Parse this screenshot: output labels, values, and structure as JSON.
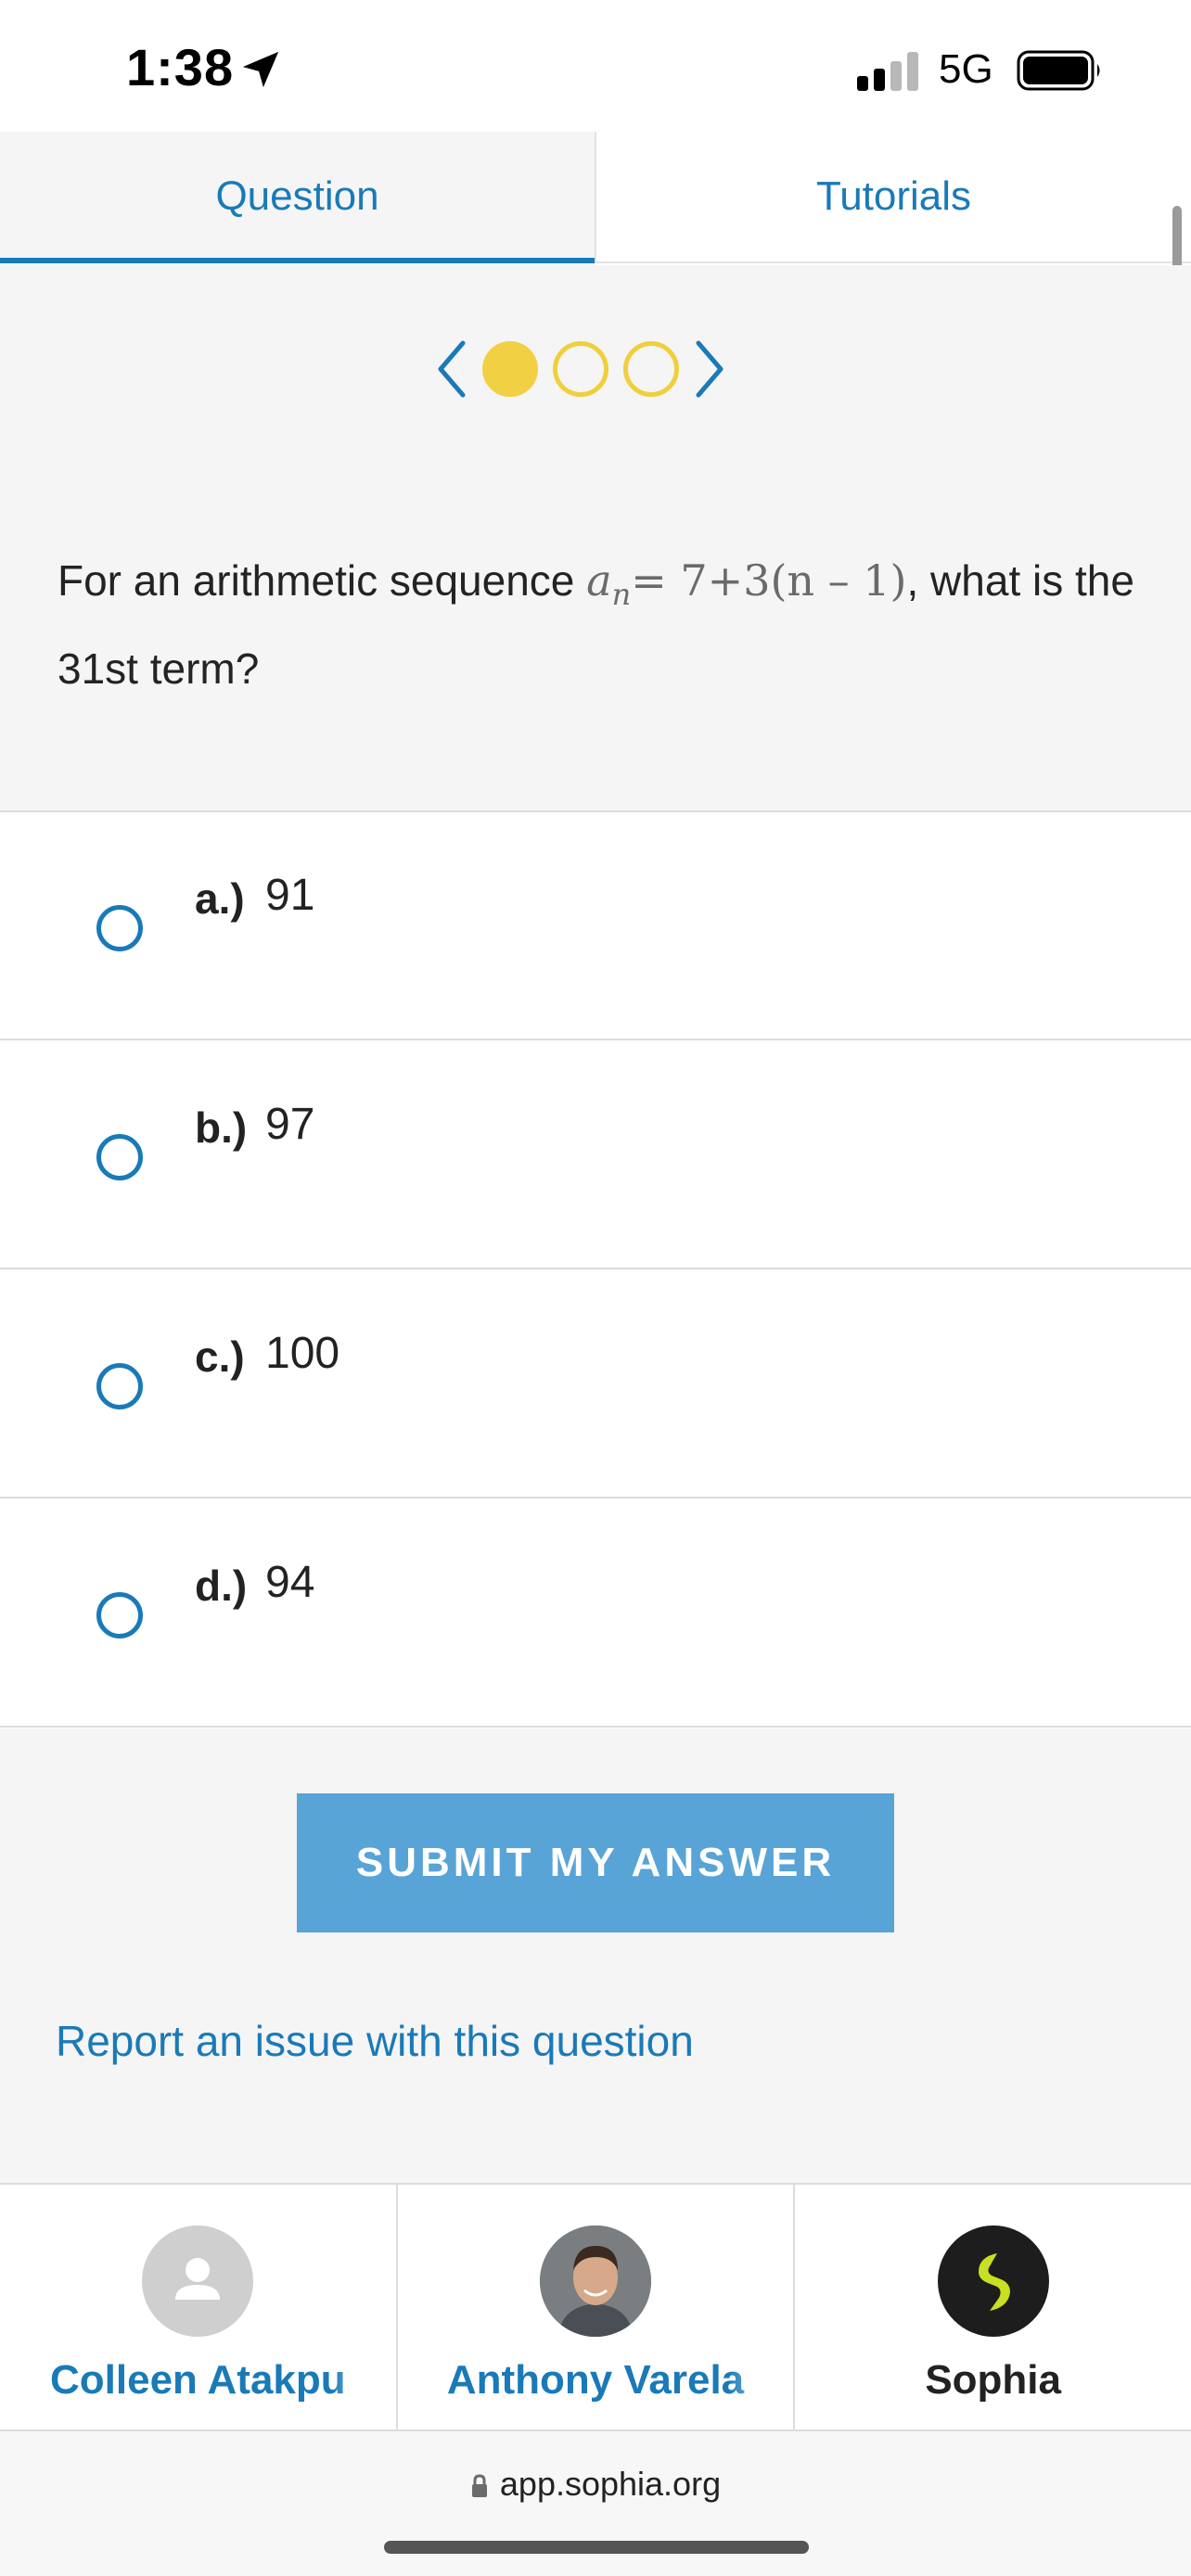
{
  "status_bar": {
    "time": "1:38",
    "network": "5G"
  },
  "tabs": [
    {
      "label": "Question",
      "active": true
    },
    {
      "label": "Tutorials",
      "active": false
    }
  ],
  "pager": {
    "current": 1,
    "total": 3
  },
  "question": {
    "prefix": "For an arithmetic sequence ",
    "formula_var": "a",
    "formula_sub": "n",
    "formula_rest": "= 7+3(n – 1)",
    "suffix": ", what is the 31st term?"
  },
  "options": [
    {
      "letter": "a.)",
      "value": "91"
    },
    {
      "letter": "b.)",
      "value": "97"
    },
    {
      "letter": "c.)",
      "value": "100"
    },
    {
      "letter": "d.)",
      "value": "94"
    }
  ],
  "submit_label": "SUBMIT MY ANSWER",
  "report_label": "Report an issue with this question",
  "people": [
    {
      "name": "Colleen Atakpu"
    },
    {
      "name": "Anthony Varela"
    },
    {
      "name": "Sophia"
    }
  ],
  "url": "app.sophia.org",
  "colors": {
    "accent": "#1a7ab8",
    "button": "#58a4d6",
    "pager_dot": "#f2d044",
    "sophia_logo": "#c8e021"
  }
}
